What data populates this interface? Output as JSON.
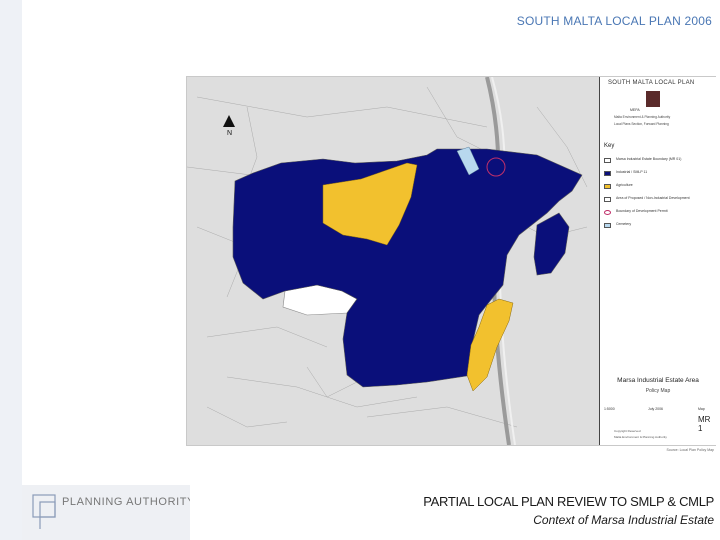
{
  "header": {
    "title": "SOUTH MALTA LOCAL PLAN 2006"
  },
  "legend": {
    "plan_title": "SOUTH MALTA LOCAL PLAN",
    "logo_caption": "MEPA",
    "notes": [
      "Malta Environment & Planning Authority",
      "Local Plans Section, Forward Planning"
    ],
    "key_title": "Key",
    "items": [
      {
        "label": "Marsa Industrial Estate Boundary (MR 01)",
        "color": "#ffffff"
      },
      {
        "label": "Industrial / SMLP 11",
        "color": "#0a0f7a"
      },
      {
        "label": "Agriculture",
        "color": "#f2c12e"
      },
      {
        "label": "Area of Proposed / Non-Industrial Development",
        "color": "#ffffff"
      },
      {
        "label": "Boundary of Development Permit",
        "color": "#ffffff"
      },
      {
        "label": "Cemetery",
        "color": "#b8d8ee"
      }
    ],
    "map_title": "Marsa Industrial Estate Area",
    "map_subtitle": "Policy Map",
    "scale_label": "1:5000",
    "date_label": "July 2006",
    "map_label": "Map",
    "map_number": "MR 1",
    "footer_notes": [
      "Copyright Reserved",
      "Malta Environment & Planning Authority"
    ]
  },
  "map_credit": "Source: Local Plan Policy Map",
  "footer": {
    "logo_text": "PLANNING AUTHORITY",
    "title": "PARTIAL LOCAL PLAN REVIEW TO SMLP & CMLP",
    "subtitle": "Context of Marsa Industrial Estate"
  },
  "colors": {
    "accent_blue": "#4a77b4",
    "industrial": "#0a0f7a",
    "agriculture": "#f2c12e"
  },
  "icons": {
    "north_arrow": "north-arrow-icon",
    "logo": "planning-authority-logo-icon"
  }
}
